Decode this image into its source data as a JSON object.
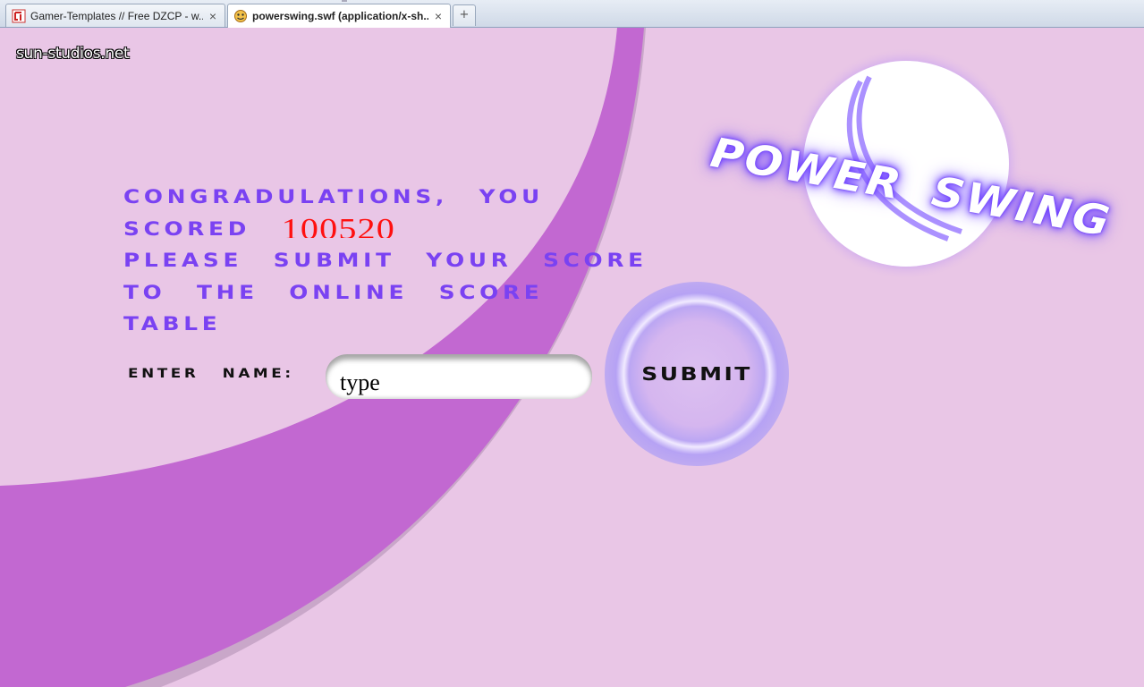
{
  "browser": {
    "tabs": [
      {
        "label": "Gamer-Templates // Free DZCP - w...",
        "active": false,
        "icon": "gamer-templates-favicon"
      },
      {
        "label": "powerswing.swf (application/x-sh...",
        "active": true,
        "icon": "flash-favicon"
      }
    ],
    "close_glyph": "×",
    "new_tab_glyph": "+"
  },
  "game": {
    "site": "sun-studios.net",
    "logo": "POWER SWING",
    "message": {
      "line1": "Congradulations, you",
      "line2_prefix": "scored",
      "score": "100520",
      "line3": "please submit your score",
      "line4": "to the online score",
      "line5": "table"
    },
    "enter_label": "enter name:",
    "name_value": "type",
    "submit_label": "SUBMIT",
    "colors": {
      "background": "#e9c6e6",
      "arc": "#c268d1",
      "arc_shadow": "#c8a8c8",
      "message_text": "#7a42f2",
      "score_text": "#ff1010",
      "logo_glow": "#7a50ff"
    }
  }
}
